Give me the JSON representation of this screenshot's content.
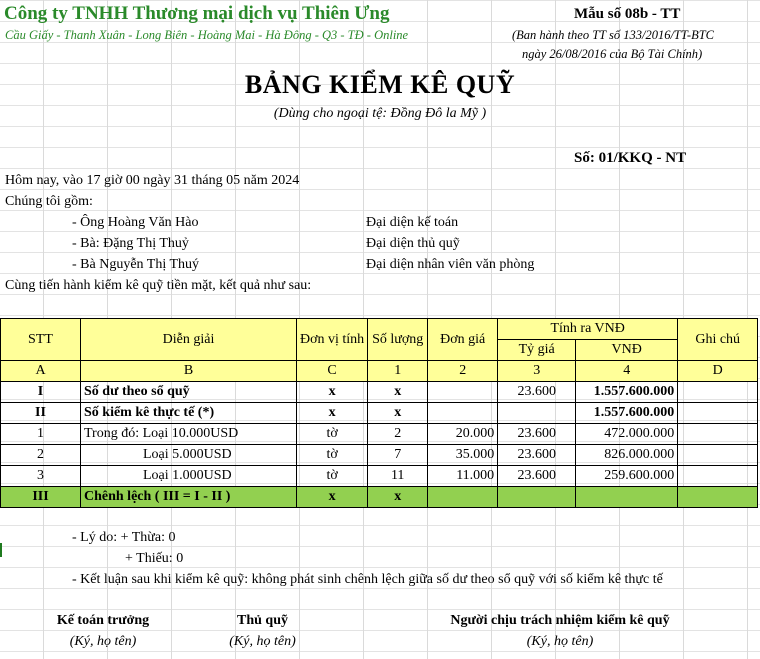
{
  "header": {
    "company": "Công ty TNHH Thương mại dịch vụ Thiên Ưng",
    "locations": "Cầu Giấy - Thanh Xuân - Long Biên - Hoàng Mai - Hà Đông - Q3 - TĐ - Online",
    "form_no": "Mẫu số 08b - TT",
    "decree_line1": "(Ban hành theo TT số 133/2016/TT-BTC",
    "decree_line2": "ngày 26/08/2016 của Bộ Tài Chính)"
  },
  "title": "BẢNG KIỂM KÊ QUỸ",
  "subtitle": "(Dùng cho ngoại tệ: Đồng Đô la Mỹ )",
  "doc_no": "Số: 01/KKQ - NT",
  "intro": {
    "date_line": "Hôm nay, vào 17 giờ 00 ngày 31 tháng 05 năm 2024",
    "we_are": "Chúng tôi gồm:",
    "members": [
      {
        "name": "- Ông Hoàng Văn Hào",
        "role": "Đại diện kế toán"
      },
      {
        "name": "- Bà: Đặng Thị Thuỷ",
        "role": "Đại diện thủ quỹ"
      },
      {
        "name": "- Bà Nguyễn Thị Thuý",
        "role": "Đại diện nhân viên văn phòng"
      }
    ],
    "result_line": "Cùng tiến hành kiểm kê quỹ tiền mặt, kết quả như sau:"
  },
  "table": {
    "headers": {
      "stt": "STT",
      "dien_giai": "Diễn giải",
      "don_vi": "Đơn vị tính",
      "so_luong": "Số lượng",
      "don_gia": "Đơn giá",
      "tinh_ra": "Tính ra VNĐ",
      "ty_gia": "Tỷ giá",
      "vnd": "VNĐ",
      "ghi_chu": "Ghi chú"
    },
    "codes": [
      "A",
      "B",
      "C",
      "1",
      "2",
      "3",
      "4",
      "D"
    ],
    "rows": [
      {
        "stt": "I",
        "desc": "Số dư theo sổ quỹ",
        "unit": "x",
        "qty": "x",
        "price": "",
        "rate": "23.600",
        "vnd": "1.557.600.000",
        "note": ""
      },
      {
        "stt": "II",
        "desc": "Số kiểm kê thực tế (*)",
        "unit": "x",
        "qty": "x",
        "price": "",
        "rate": "",
        "vnd": "1.557.600.000",
        "note": ""
      },
      {
        "stt": "1",
        "desc": "Trong đó: Loại 10.000USD",
        "unit": "tờ",
        "qty": "2",
        "price": "20.000",
        "rate": "23.600",
        "vnd": "472.000.000",
        "note": ""
      },
      {
        "stt": "2",
        "desc": "Loại  5.000USD",
        "unit": "tờ",
        "qty": "7",
        "price": "35.000",
        "rate": "23.600",
        "vnd": "826.000.000",
        "note": ""
      },
      {
        "stt": "3",
        "desc": "Loại  1.000USD",
        "unit": "tờ",
        "qty": "11",
        "price": "11.000",
        "rate": "23.600",
        "vnd": "259.600.000",
        "note": ""
      },
      {
        "stt": "III",
        "desc": "Chênh lệch ( III = I - II )",
        "unit": "x",
        "qty": "x",
        "price": "",
        "rate": "",
        "vnd": "",
        "note": ""
      }
    ]
  },
  "footer": {
    "reason": "- Lý do: + Thừa: 0",
    "shortage": "+ Thiếu: 0",
    "conclusion": "- Kết luận sau khi kiểm kê quỹ: không phát sinh chênh lệch giữa số dư theo sổ quỹ với số kiểm kê thực tế"
  },
  "signatures": [
    {
      "title": "Kế toán trưởng",
      "note": "(Ký, họ tên)"
    },
    {
      "title": "Thủ quỹ",
      "note": "(Ký, họ tên)"
    },
    {
      "title": "Người chịu trách nhiệm kiểm kê quỹ",
      "note": "(Ký, họ tên)"
    }
  ],
  "colors": {
    "company": "#2a8a2a",
    "header_fill": "#ffff99",
    "diff_fill": "#92d050"
  }
}
